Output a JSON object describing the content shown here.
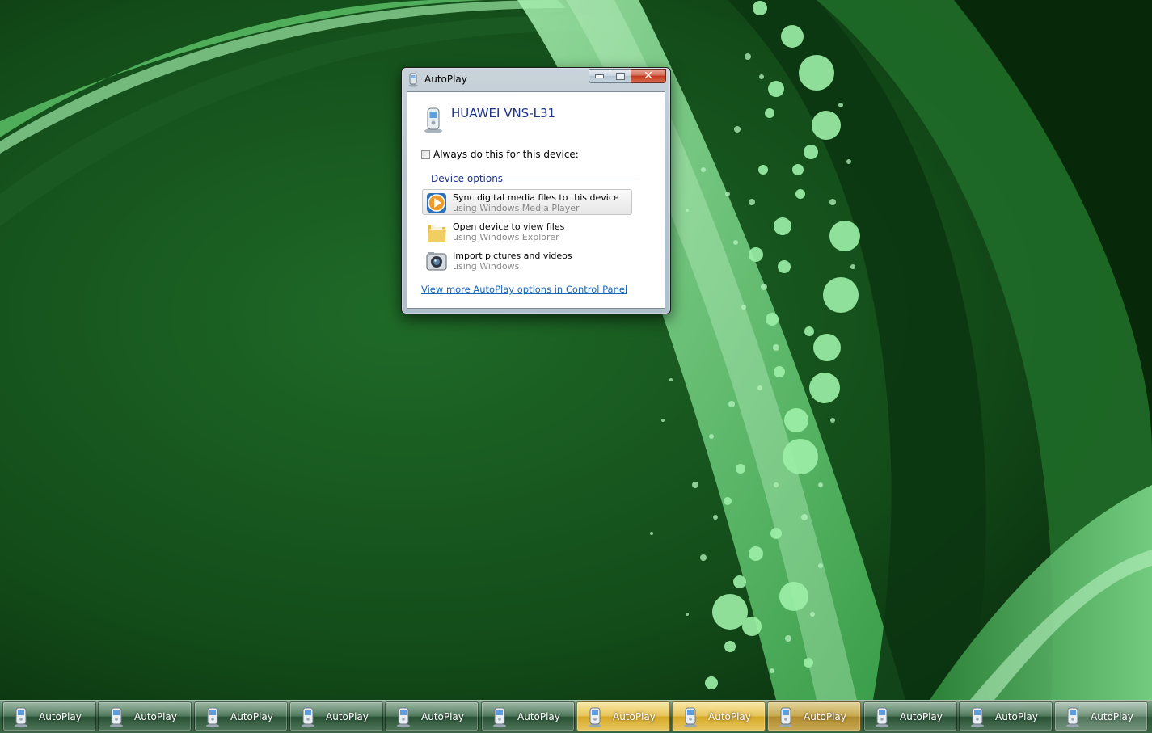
{
  "window": {
    "title": "AutoPlay",
    "device_name": "HUAWEI VNS-L31",
    "always_label": "Always do this for this device:",
    "always_checked": false,
    "group_title": "Device options",
    "options": [
      {
        "label": "Sync digital media files to this device",
        "sub": "using Windows Media Player",
        "icon": "windows-media-player-icon"
      },
      {
        "label": "Open device to view files",
        "sub": "using Windows Explorer",
        "icon": "folder-icon"
      },
      {
        "label": "Import pictures and videos",
        "sub": "using Windows",
        "icon": "camera-icon"
      }
    ],
    "control_panel_link": "View more AutoPlay options in Control Panel"
  },
  "taskbar": {
    "buttons": [
      {
        "label": "AutoPlay",
        "state": "normal"
      },
      {
        "label": "AutoPlay",
        "state": "normal"
      },
      {
        "label": "AutoPlay",
        "state": "normal"
      },
      {
        "label": "AutoPlay",
        "state": "normal"
      },
      {
        "label": "AutoPlay",
        "state": "normal"
      },
      {
        "label": "AutoPlay",
        "state": "normal"
      },
      {
        "label": "AutoPlay",
        "state": "flashing"
      },
      {
        "label": "AutoPlay",
        "state": "flashing"
      },
      {
        "label": "AutoPlay",
        "state": "flashing"
      },
      {
        "label": "AutoPlay",
        "state": "normal"
      },
      {
        "label": "AutoPlay",
        "state": "normal"
      },
      {
        "label": "AutoPlay",
        "state": "active"
      }
    ]
  },
  "colors": {
    "wallpaper_dark": "#0e3d12",
    "wallpaper_light": "#8fe39b",
    "heading_blue": "#1e3287",
    "link_blue": "#1b66b8"
  }
}
